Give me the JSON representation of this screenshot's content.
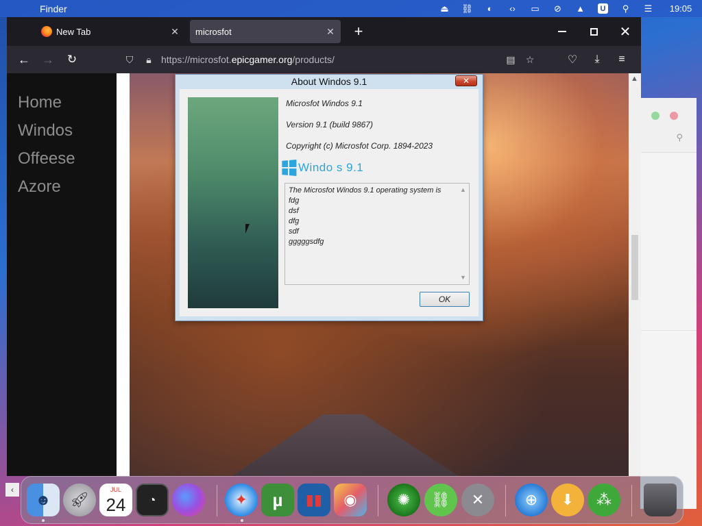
{
  "menubar": {
    "app_name": "Finder",
    "clock": "19:05",
    "u_badge": "U"
  },
  "browser": {
    "tabs": [
      {
        "label": "New Tab",
        "close": "✕"
      },
      {
        "label": "microsfot",
        "close": "✕"
      }
    ],
    "new_tab": "+",
    "url_prefix": "https://microsfot.",
    "url_domain": "epicgamer.org",
    "url_path": "/products/"
  },
  "sidebar": {
    "items": [
      "Home",
      "Windos",
      "Offeese",
      "Azore"
    ]
  },
  "dialog": {
    "title": "About Windos 9.1",
    "close": "✕",
    "product": "Microsfot Windos 9.1",
    "version": "Version 9.1 (build 9867)",
    "copyright": "Copyright (c) Microsfot Corp. 1894-2023",
    "logo_text": "Windo  s 9.1",
    "notes": [
      "The Microsfot Windos 9.1 operating system is",
      "fdg",
      "dsf",
      "dfg",
      "sdf",
      "gggggsdfg"
    ],
    "ok": "OK"
  },
  "dock": {
    "calendar_month": "JUL",
    "calendar_day": "24"
  }
}
